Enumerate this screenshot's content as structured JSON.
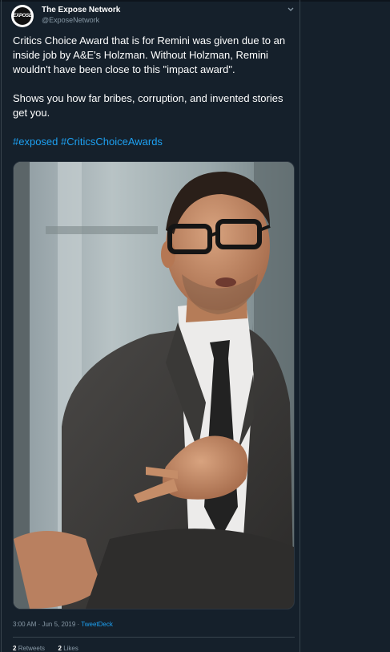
{
  "tweet": {
    "author_name": "The Expose Network",
    "author_handle": "@ExposeNetwork",
    "avatar_text": "EXPOSE",
    "text_line1": "Critics Choice Award that is for Remini was given due to an inside job by A&E's Holzman. Without Holzman, Remini wouldn't have been close to this \"impact award\".",
    "text_line2": "Shows you how far bribes, corruption, and invented stories get you.",
    "hashtags": [
      "#exposed",
      "#CriticsChoiceAwards"
    ],
    "time": "3:00 AM",
    "date": "Jun 5, 2019",
    "source": "TweetDeck",
    "retweets_count": "2",
    "retweets_label": "Retweets",
    "likes_count": "2",
    "likes_label": "Likes"
  },
  "colors": {
    "background": "#15202b",
    "text": "#ffffff",
    "muted": "#8899a6",
    "link": "#1da1f2",
    "border": "#38444d"
  },
  "icons": {
    "caret": "chevron-down-icon"
  }
}
